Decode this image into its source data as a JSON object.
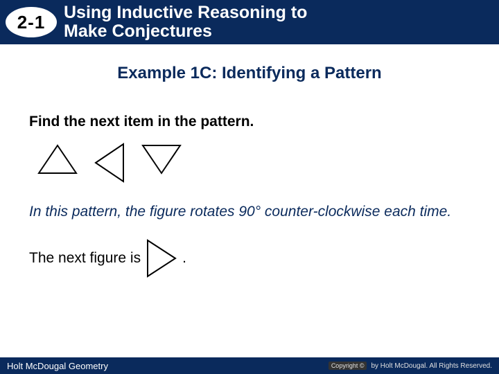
{
  "header": {
    "badge": "2-1",
    "title_line1": "Using Inductive Reasoning to",
    "title_line2": "Make Conjectures"
  },
  "example": {
    "title": "Example 1C: Identifying a Pattern",
    "instruction": "Find the next item in the pattern.",
    "explanation": "In this pattern, the figure rotates 90° counter-clockwise each time.",
    "answer_prefix": "The next figure is",
    "answer_suffix": "."
  },
  "footer": {
    "left": "Holt McDougal Geometry",
    "right_badge": "Copyright ©",
    "right_text": "by Holt McDougal. All Rights Reserved."
  }
}
